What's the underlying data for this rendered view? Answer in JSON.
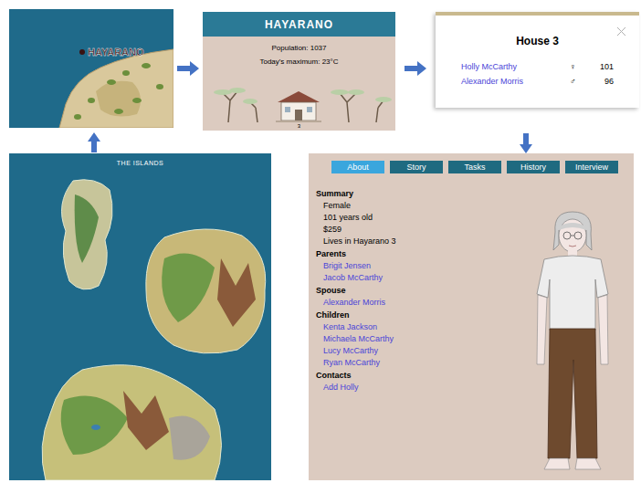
{
  "map_preview": {
    "label": "HAYARANO"
  },
  "town_card": {
    "title": "HAYARANO",
    "population": "Population: 1037",
    "max_temp": "Today's maximum: 23°C",
    "house_number": "3"
  },
  "house_dialog": {
    "title": "House 3",
    "residents": [
      {
        "name": "Holly McCarthy",
        "sex": "♀",
        "age": "101"
      },
      {
        "name": "Alexander Morris",
        "sex": "♂",
        "age": "96"
      }
    ]
  },
  "profile": {
    "tabs": [
      {
        "label": "About",
        "selected": true
      },
      {
        "label": "Story",
        "selected": false
      },
      {
        "label": "Tasks",
        "selected": false
      },
      {
        "label": "History",
        "selected": false
      },
      {
        "label": "Interview",
        "selected": false
      }
    ],
    "sections": [
      {
        "heading": "Summary",
        "items": [
          {
            "text": "Female",
            "kind": "text"
          },
          {
            "text": "101 years old",
            "kind": "text"
          },
          {
            "text": "$259",
            "kind": "text"
          },
          {
            "text": "Lives in Hayarano 3",
            "kind": "text"
          }
        ]
      },
      {
        "heading": "Parents",
        "items": [
          {
            "text": "Brigit Jensen",
            "kind": "link"
          },
          {
            "text": "Jacob McCarthy",
            "kind": "link"
          }
        ]
      },
      {
        "heading": "Spouse",
        "items": [
          {
            "text": "Alexander Morris",
            "kind": "link"
          }
        ]
      },
      {
        "heading": "Children",
        "items": [
          {
            "text": "Kenta Jackson",
            "kind": "link"
          },
          {
            "text": "Michaela McCarthy",
            "kind": "link"
          },
          {
            "text": "Lucy McCarthy",
            "kind": "link"
          },
          {
            "text": "Ryan McCarthy",
            "kind": "link"
          }
        ]
      },
      {
        "heading": "Contacts",
        "items": [
          {
            "text": "Add Holly",
            "kind": "link"
          }
        ]
      }
    ]
  },
  "world_map": {
    "title": "THE ISLANDS"
  }
}
